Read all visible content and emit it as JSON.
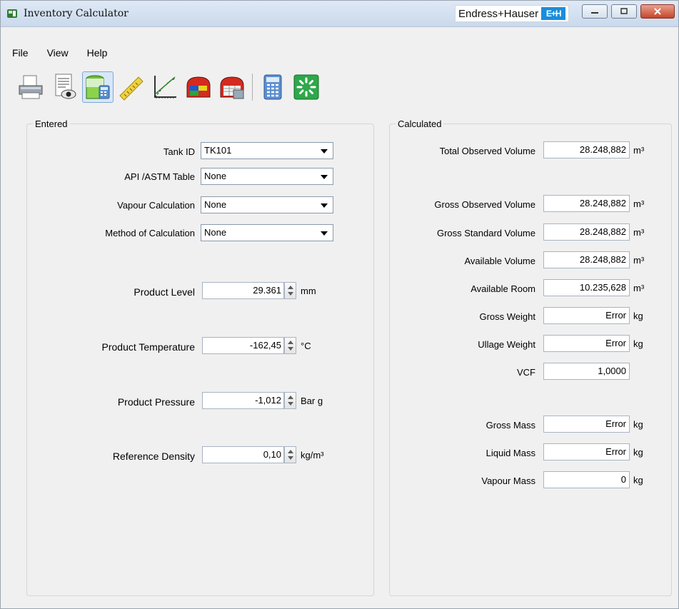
{
  "window": {
    "title": "Inventory Calculator",
    "brand": "Endress+Hauser",
    "brand_logo": "E+H"
  },
  "menu": [
    "File",
    "View",
    "Help"
  ],
  "toolbar": [
    {
      "icon": "printer-icon"
    },
    {
      "icon": "print-preview-icon"
    },
    {
      "icon": "tank-calculator-icon",
      "active": true
    },
    {
      "icon": "ruler-icon"
    },
    {
      "icon": "chart-icon"
    },
    {
      "icon": "tank-colors-icon"
    },
    {
      "icon": "tank-table-icon"
    },
    {
      "icon": "calculator-icon"
    },
    {
      "icon": "refresh-icon"
    }
  ],
  "entered": {
    "legend": "Entered",
    "tank_id": {
      "label": "Tank ID",
      "value": "TK101"
    },
    "api_table": {
      "label": "API /ASTM Table",
      "value": "None"
    },
    "vapour_calc": {
      "label": "Vapour Calculation",
      "value": "None"
    },
    "method": {
      "label": "Method of Calculation",
      "value": "None"
    },
    "product_level": {
      "label": "Product Level",
      "value": "29.361",
      "unit": "mm"
    },
    "product_temp": {
      "label": "Product Temperature",
      "value": "-162,45",
      "unit": "°C"
    },
    "product_pressure": {
      "label": "Product Pressure",
      "value": "-1,012",
      "unit": "Bar g"
    },
    "ref_density": {
      "label": "Reference Density",
      "value": "0,10",
      "unit": "kg/m³"
    }
  },
  "calculated": {
    "legend": "Calculated",
    "rows": [
      {
        "label": "Total Observed Volume",
        "value": "28.248,882",
        "unit": "m³"
      },
      {
        "label": "Gross Observed Volume",
        "value": "28.248,882",
        "unit": "m³"
      },
      {
        "label": "Gross Standard Volume",
        "value": "28.248,882",
        "unit": "m³"
      },
      {
        "label": "Available Volume",
        "value": "28.248,882",
        "unit": "m³"
      },
      {
        "label": "Available Room",
        "value": "10.235,628",
        "unit": "m³"
      },
      {
        "label": "Gross Weight",
        "value": "Error",
        "unit": "kg"
      },
      {
        "label": "Ullage Weight",
        "value": "Error",
        "unit": "kg"
      },
      {
        "label": "VCF",
        "value": "1,0000",
        "unit": ""
      },
      {
        "label": "Gross Mass",
        "value": "Error",
        "unit": "kg"
      },
      {
        "label": "Liquid Mass",
        "value": "Error",
        "unit": "kg"
      },
      {
        "label": "Vapour Mass",
        "value": "0",
        "unit": "kg"
      }
    ]
  }
}
